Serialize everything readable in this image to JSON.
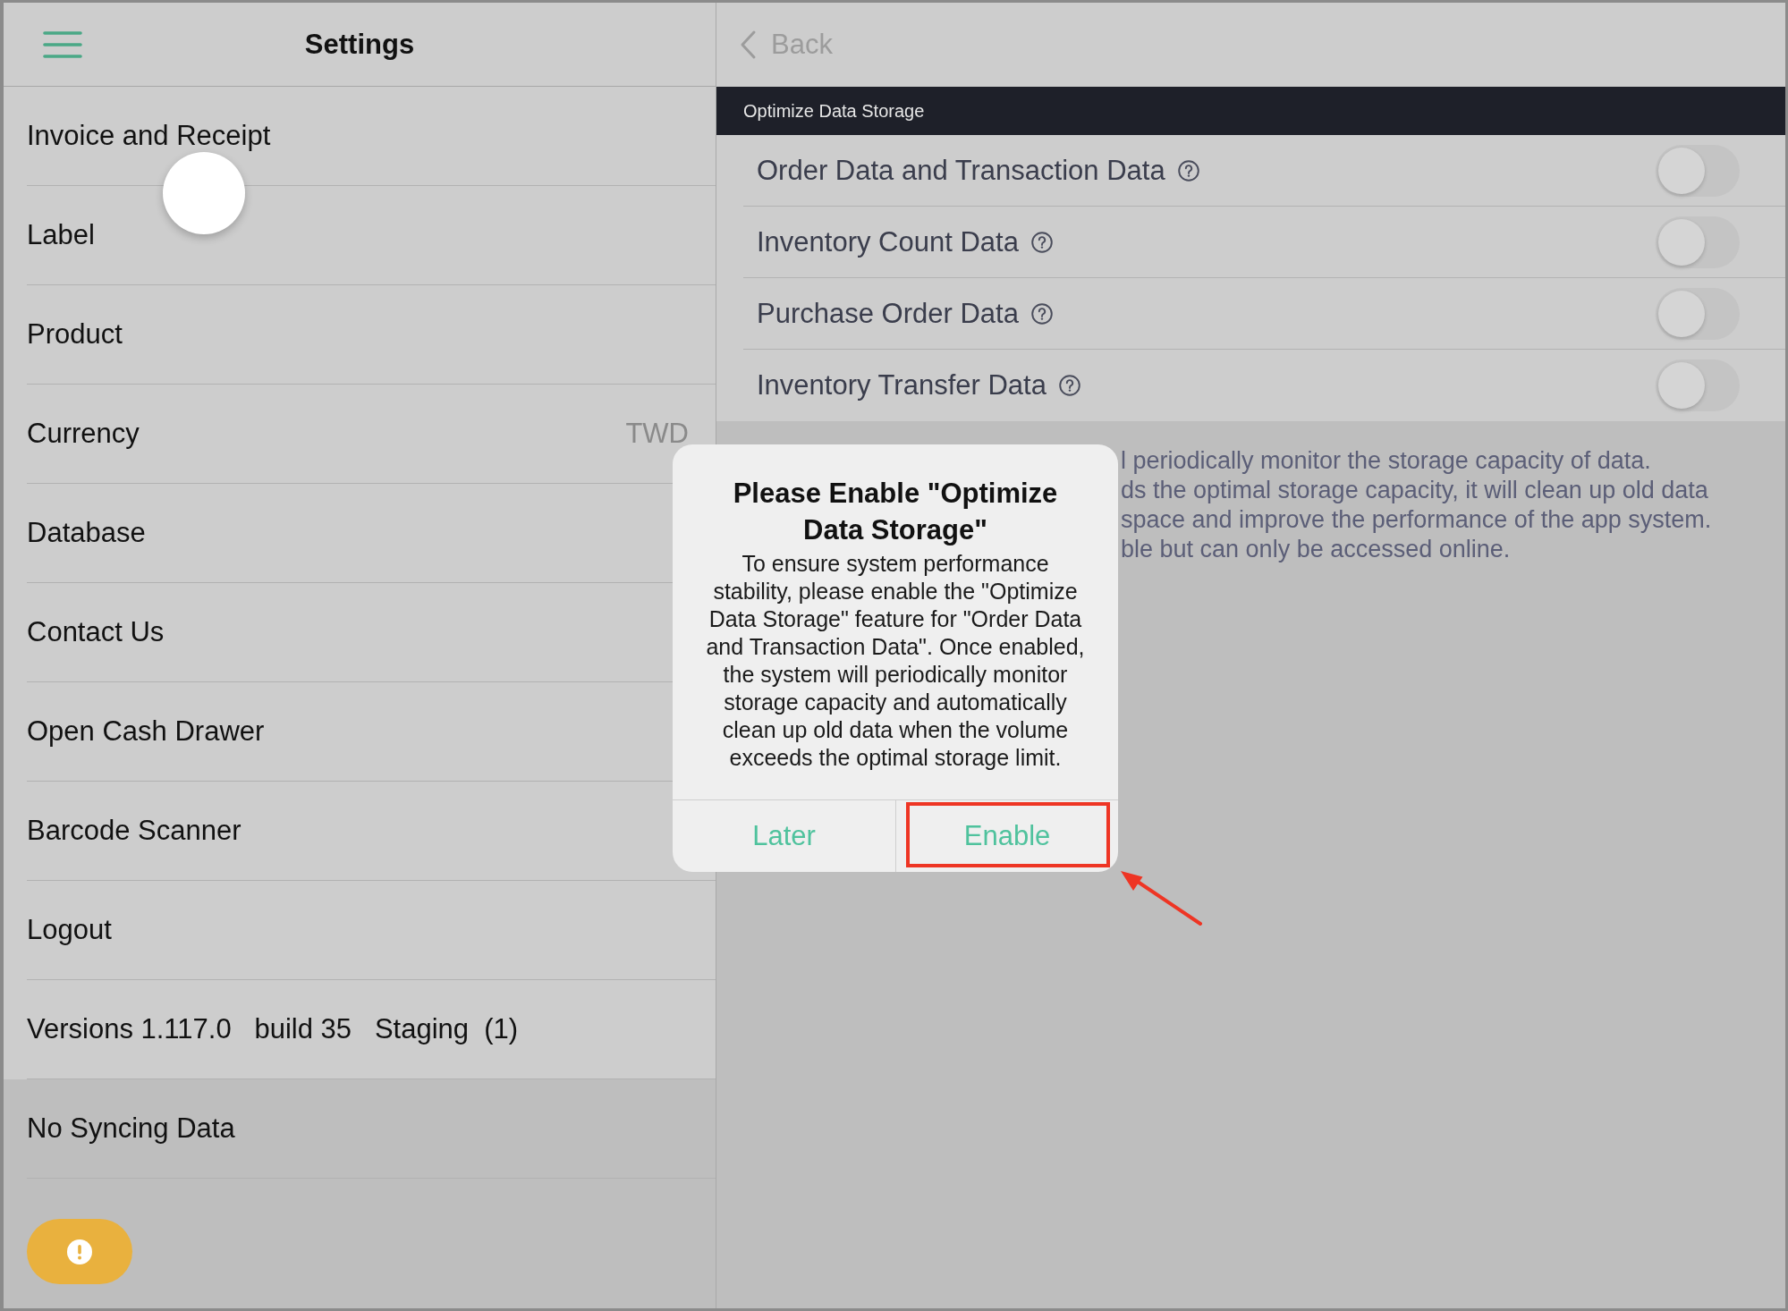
{
  "sidebar": {
    "title": "Settings",
    "items": [
      {
        "label": "Invoice and Receipt"
      },
      {
        "label": "Label"
      },
      {
        "label": "Product"
      },
      {
        "label": "Currency",
        "value": "TWD"
      },
      {
        "label": "Database"
      },
      {
        "label": "Contact Us"
      },
      {
        "label": "Open Cash Drawer"
      },
      {
        "label": "Barcode Scanner"
      },
      {
        "label": "Logout"
      },
      {
        "label": "Versions 1.117.0   build 35   Staging  (1)"
      }
    ],
    "sync_status": "No Syncing Data"
  },
  "detail": {
    "back": "Back",
    "section_title": "Optimize Data Storage",
    "options": [
      {
        "label": "Order Data and Transaction Data",
        "on": false
      },
      {
        "label": "Inventory Count Data",
        "on": false
      },
      {
        "label": "Purchase Order Data",
        "on": false
      },
      {
        "label": "Inventory Transfer Data",
        "on": false
      }
    ],
    "description_lines": [
      "l periodically monitor the storage capacity of data.",
      "ds the optimal storage capacity, it will clean up old data",
      "space and improve the performance of the app system.",
      "ble but can only be accessed online."
    ]
  },
  "dialog": {
    "title": "Please Enable \"Optimize Data Storage\"",
    "message": "To ensure system performance stability, please enable the \"Optimize Data Storage\" feature for \"Order Data and Transaction Data\". Once enabled, the system will periodically monitor storage capacity and automatically clean up old data when the volume exceeds the optimal storage limit.",
    "buttons": [
      {
        "label": "Later",
        "highlighted": false
      },
      {
        "label": "Enable",
        "highlighted": true
      }
    ]
  }
}
